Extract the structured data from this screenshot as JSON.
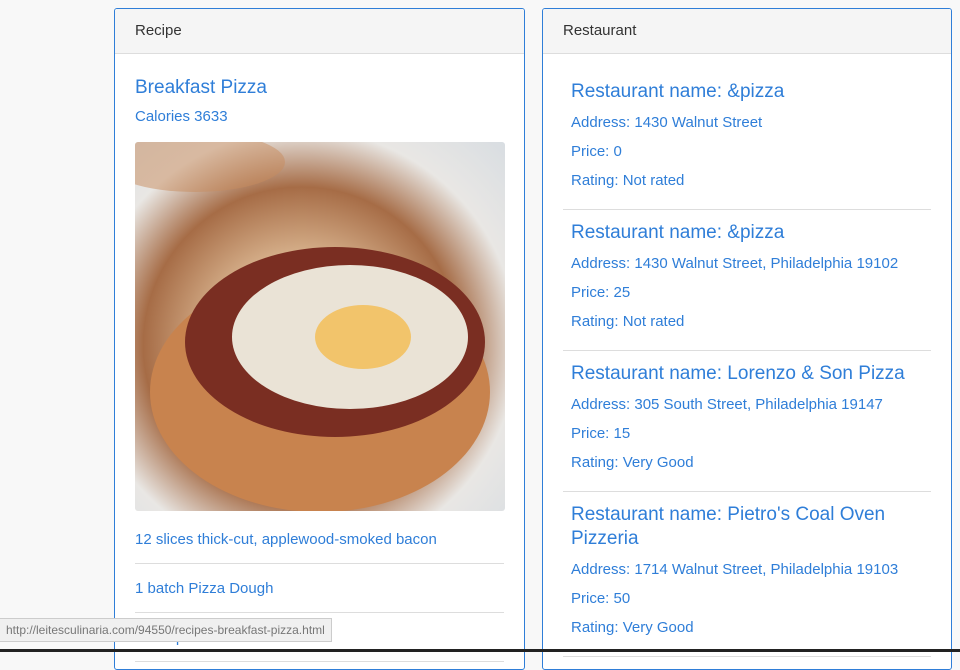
{
  "recipe": {
    "header": "Recipe",
    "title": "Breakfast Pizza",
    "calories": "Calories 3633",
    "image_alt": "Breakfast pizza with egg and bacon",
    "ingredients": [
      "12 slices thick-cut, applewood-smoked bacon",
      "1 batch Pizza Dough",
      "1/2 cup crème fraîche"
    ]
  },
  "restaurant": {
    "header": "Restaurant",
    "items": [
      {
        "name": "Restaurant name: &pizza",
        "address": "Address: 1430 Walnut Street",
        "price": "Price: 0",
        "rating": "Rating: Not rated"
      },
      {
        "name": "Restaurant name: &pizza",
        "address": "Address: 1430 Walnut Street, Philadelphia 19102",
        "price": "Price: 25",
        "rating": "Rating: Not rated"
      },
      {
        "name": "Restaurant name: Lorenzo & Son Pizza",
        "address": "Address: 305 South Street, Philadelphia 19147",
        "price": "Price: 15",
        "rating": "Rating: Very Good"
      },
      {
        "name": "Restaurant name: Pietro's Coal Oven Pizzeria",
        "address": "Address: 1714 Walnut Street, Philadelphia 19103",
        "price": "Price: 50",
        "rating": "Rating: Very Good"
      }
    ]
  },
  "status_bar": {
    "url": "http://leitesculinaria.com/94550/recipes-breakfast-pizza.html"
  },
  "colors": {
    "accent": "#2f7ed8",
    "border": "#dddddd",
    "header_bg": "#f5f5f5"
  }
}
